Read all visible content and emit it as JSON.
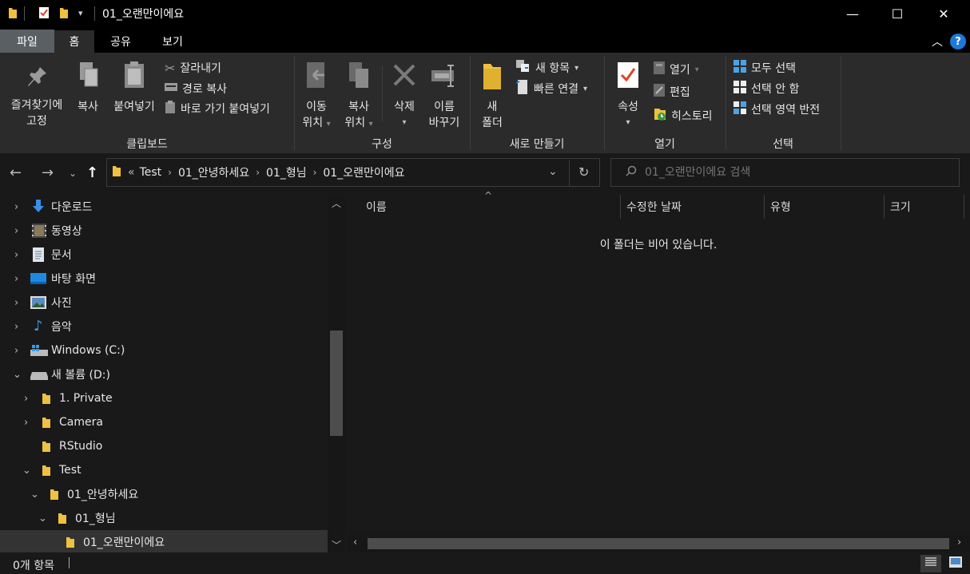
{
  "window": {
    "title": "01_오랜만이에요",
    "minimize_label": "—",
    "maximize_label": "☐",
    "close_label": "✕"
  },
  "ribbon_tabs": {
    "file": "파일",
    "home": "홈",
    "share": "공유",
    "view": "보기"
  },
  "clipboard": {
    "pin_line1": "즐겨찾기에",
    "pin_line2": "고정",
    "copy": "복사",
    "paste": "붙여넣기",
    "cut": "잘라내기",
    "copy_path": "경로 복사",
    "paste_shortcut": "바로 가기 붙여넣기",
    "group": "클립보드"
  },
  "organize": {
    "move_line1": "이동",
    "move_line2": "위치",
    "copy_line1": "복사",
    "copy_line2": "위치",
    "delete": "삭제",
    "rename_line1": "이름",
    "rename_line2": "바꾸기",
    "group": "구성"
  },
  "new": {
    "folder_line1": "새",
    "folder_line2": "폴더",
    "new_item": "새 항목",
    "easy_access": "빠른 연결",
    "group": "새로 만들기"
  },
  "open": {
    "properties": "속성",
    "open": "열기",
    "edit": "편집",
    "history": "히스토리",
    "group": "열기"
  },
  "select": {
    "select_all": "모두 선택",
    "select_none": "선택 안 함",
    "invert": "선택 영역 반전",
    "group": "선택"
  },
  "address": {
    "overflow": "«",
    "crumbs": [
      "Test",
      "01_안녕하세요",
      "01_형님",
      "01_오랜만이에요"
    ]
  },
  "search": {
    "placeholder": "01_오랜만이에요 검색"
  },
  "tree": [
    {
      "label": "다운로드"
    },
    {
      "label": "동영상"
    },
    {
      "label": "문서"
    },
    {
      "label": "바탕 화면"
    },
    {
      "label": "사진"
    },
    {
      "label": "음악"
    },
    {
      "label": "Windows (C:)"
    },
    {
      "label": "새 볼륨 (D:)"
    },
    {
      "label": "1. Private"
    },
    {
      "label": "Camera"
    },
    {
      "label": "RStudio"
    },
    {
      "label": "Test"
    },
    {
      "label": "01_안녕하세요"
    },
    {
      "label": "01_형님"
    },
    {
      "label": "01_오랜만이에요"
    }
  ],
  "columns": {
    "name": "이름",
    "modified": "수정한 날짜",
    "type": "유형",
    "size": "크기"
  },
  "empty_message": "이 폴더는 비어 있습니다.",
  "status": {
    "count": "0개 항목"
  },
  "colors": {
    "folder": "#f0c040",
    "accent_blue": "#1e90ff",
    "background": "#191919",
    "ribbon": "#2b2b2b"
  }
}
